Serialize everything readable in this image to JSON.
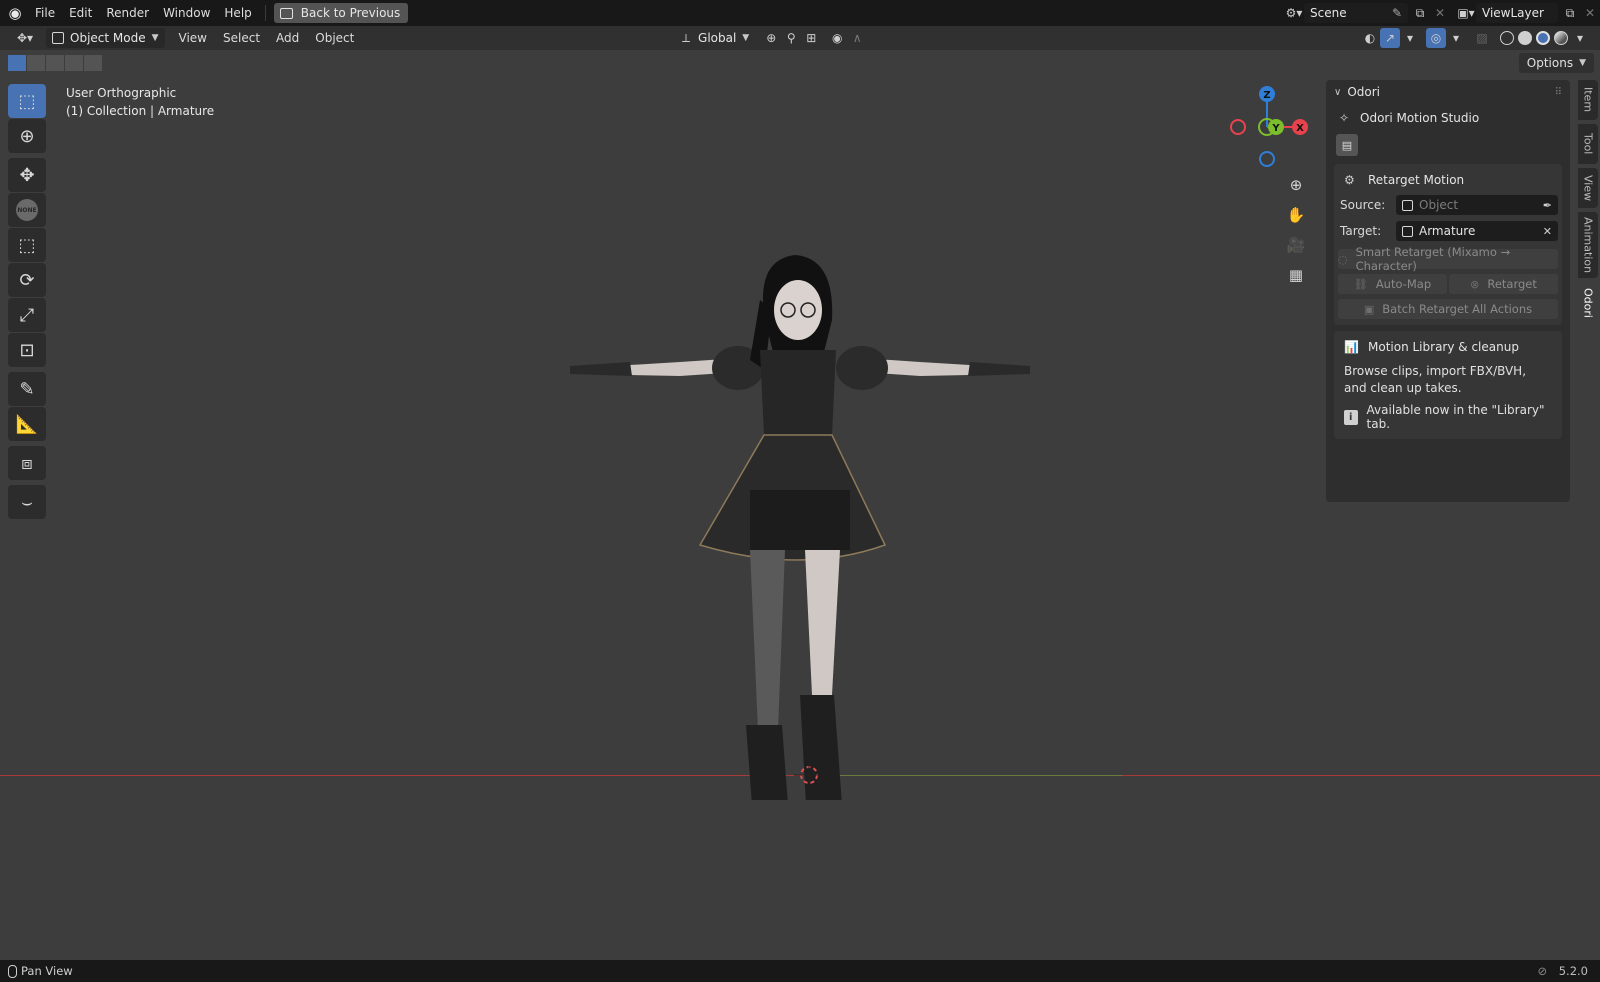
{
  "menubar": {
    "items": [
      "File",
      "Edit",
      "Render",
      "Window",
      "Help"
    ],
    "back_button": "Back to Previous",
    "scene": "Scene",
    "view_layer": "ViewLayer"
  },
  "header": {
    "mode": "Object Mode",
    "menus": [
      "View",
      "Select",
      "Add",
      "Object"
    ],
    "transform_orientation": "Global"
  },
  "viewport": {
    "view_name": "User Orthographic",
    "context": "(1) Collection | Armature",
    "options_label": "Options",
    "gizmo_axes": {
      "z": "Z",
      "y": "Y",
      "x": "X"
    }
  },
  "toolbar": {
    "none_badge": "NONE"
  },
  "npanel": {
    "panel_title": "Odori",
    "addon_name": "Odori Motion Studio",
    "retarget": {
      "title": "Retarget Motion",
      "source_label": "Source:",
      "source_placeholder": "Object",
      "target_label": "Target:",
      "target_value": "Armature",
      "smart_retarget": "Smart Retarget (Mixamo → Character)",
      "auto_map": "Auto-Map",
      "retarget": "Retarget",
      "batch": "Batch Retarget All Actions"
    },
    "library": {
      "title": "Motion Library & cleanup",
      "description": "Browse clips, import FBX/BVH, and clean up takes.",
      "info": "Available now in the \"Library\" tab."
    }
  },
  "vtabs": [
    "Item",
    "Tool",
    "View",
    "Animation",
    "Odori"
  ],
  "active_vtab": "Odori",
  "statusbar": {
    "hint": "Pan View",
    "version": "5.2.0"
  },
  "colors": {
    "accent": "#4772b3",
    "axis_x": "#e8424e",
    "axis_y": "#7cbd2c",
    "axis_z": "#2f7fd8"
  }
}
